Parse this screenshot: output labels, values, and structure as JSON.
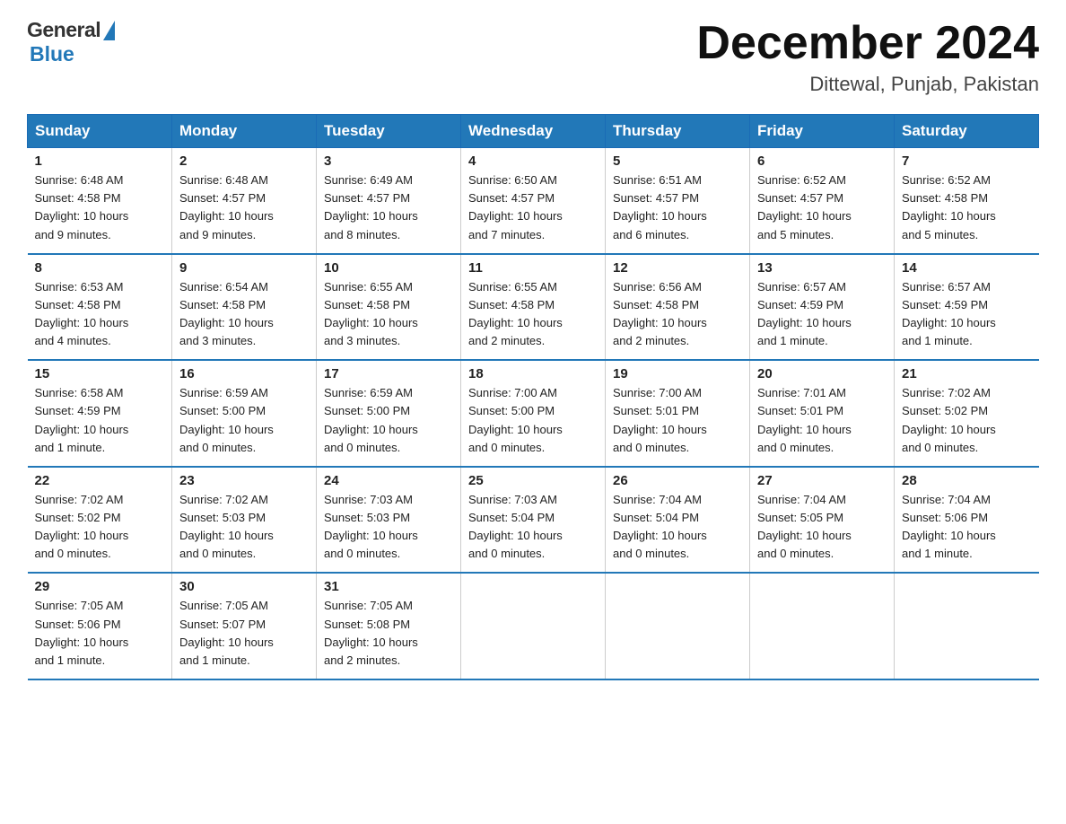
{
  "header": {
    "logo_general": "General",
    "logo_blue": "Blue",
    "month_title": "December 2024",
    "location": "Dittewal, Punjab, Pakistan"
  },
  "days_of_week": [
    "Sunday",
    "Monday",
    "Tuesday",
    "Wednesday",
    "Thursday",
    "Friday",
    "Saturday"
  ],
  "weeks": [
    [
      {
        "day": "1",
        "info": "Sunrise: 6:48 AM\nSunset: 4:58 PM\nDaylight: 10 hours\nand 9 minutes."
      },
      {
        "day": "2",
        "info": "Sunrise: 6:48 AM\nSunset: 4:57 PM\nDaylight: 10 hours\nand 9 minutes."
      },
      {
        "day": "3",
        "info": "Sunrise: 6:49 AM\nSunset: 4:57 PM\nDaylight: 10 hours\nand 8 minutes."
      },
      {
        "day": "4",
        "info": "Sunrise: 6:50 AM\nSunset: 4:57 PM\nDaylight: 10 hours\nand 7 minutes."
      },
      {
        "day": "5",
        "info": "Sunrise: 6:51 AM\nSunset: 4:57 PM\nDaylight: 10 hours\nand 6 minutes."
      },
      {
        "day": "6",
        "info": "Sunrise: 6:52 AM\nSunset: 4:57 PM\nDaylight: 10 hours\nand 5 minutes."
      },
      {
        "day": "7",
        "info": "Sunrise: 6:52 AM\nSunset: 4:58 PM\nDaylight: 10 hours\nand 5 minutes."
      }
    ],
    [
      {
        "day": "8",
        "info": "Sunrise: 6:53 AM\nSunset: 4:58 PM\nDaylight: 10 hours\nand 4 minutes."
      },
      {
        "day": "9",
        "info": "Sunrise: 6:54 AM\nSunset: 4:58 PM\nDaylight: 10 hours\nand 3 minutes."
      },
      {
        "day": "10",
        "info": "Sunrise: 6:55 AM\nSunset: 4:58 PM\nDaylight: 10 hours\nand 3 minutes."
      },
      {
        "day": "11",
        "info": "Sunrise: 6:55 AM\nSunset: 4:58 PM\nDaylight: 10 hours\nand 2 minutes."
      },
      {
        "day": "12",
        "info": "Sunrise: 6:56 AM\nSunset: 4:58 PM\nDaylight: 10 hours\nand 2 minutes."
      },
      {
        "day": "13",
        "info": "Sunrise: 6:57 AM\nSunset: 4:59 PM\nDaylight: 10 hours\nand 1 minute."
      },
      {
        "day": "14",
        "info": "Sunrise: 6:57 AM\nSunset: 4:59 PM\nDaylight: 10 hours\nand 1 minute."
      }
    ],
    [
      {
        "day": "15",
        "info": "Sunrise: 6:58 AM\nSunset: 4:59 PM\nDaylight: 10 hours\nand 1 minute."
      },
      {
        "day": "16",
        "info": "Sunrise: 6:59 AM\nSunset: 5:00 PM\nDaylight: 10 hours\nand 0 minutes."
      },
      {
        "day": "17",
        "info": "Sunrise: 6:59 AM\nSunset: 5:00 PM\nDaylight: 10 hours\nand 0 minutes."
      },
      {
        "day": "18",
        "info": "Sunrise: 7:00 AM\nSunset: 5:00 PM\nDaylight: 10 hours\nand 0 minutes."
      },
      {
        "day": "19",
        "info": "Sunrise: 7:00 AM\nSunset: 5:01 PM\nDaylight: 10 hours\nand 0 minutes."
      },
      {
        "day": "20",
        "info": "Sunrise: 7:01 AM\nSunset: 5:01 PM\nDaylight: 10 hours\nand 0 minutes."
      },
      {
        "day": "21",
        "info": "Sunrise: 7:02 AM\nSunset: 5:02 PM\nDaylight: 10 hours\nand 0 minutes."
      }
    ],
    [
      {
        "day": "22",
        "info": "Sunrise: 7:02 AM\nSunset: 5:02 PM\nDaylight: 10 hours\nand 0 minutes."
      },
      {
        "day": "23",
        "info": "Sunrise: 7:02 AM\nSunset: 5:03 PM\nDaylight: 10 hours\nand 0 minutes."
      },
      {
        "day": "24",
        "info": "Sunrise: 7:03 AM\nSunset: 5:03 PM\nDaylight: 10 hours\nand 0 minutes."
      },
      {
        "day": "25",
        "info": "Sunrise: 7:03 AM\nSunset: 5:04 PM\nDaylight: 10 hours\nand 0 minutes."
      },
      {
        "day": "26",
        "info": "Sunrise: 7:04 AM\nSunset: 5:04 PM\nDaylight: 10 hours\nand 0 minutes."
      },
      {
        "day": "27",
        "info": "Sunrise: 7:04 AM\nSunset: 5:05 PM\nDaylight: 10 hours\nand 0 minutes."
      },
      {
        "day": "28",
        "info": "Sunrise: 7:04 AM\nSunset: 5:06 PM\nDaylight: 10 hours\nand 1 minute."
      }
    ],
    [
      {
        "day": "29",
        "info": "Sunrise: 7:05 AM\nSunset: 5:06 PM\nDaylight: 10 hours\nand 1 minute."
      },
      {
        "day": "30",
        "info": "Sunrise: 7:05 AM\nSunset: 5:07 PM\nDaylight: 10 hours\nand 1 minute."
      },
      {
        "day": "31",
        "info": "Sunrise: 7:05 AM\nSunset: 5:08 PM\nDaylight: 10 hours\nand 2 minutes."
      },
      {
        "day": "",
        "info": ""
      },
      {
        "day": "",
        "info": ""
      },
      {
        "day": "",
        "info": ""
      },
      {
        "day": "",
        "info": ""
      }
    ]
  ],
  "accent_color": "#2278b8"
}
